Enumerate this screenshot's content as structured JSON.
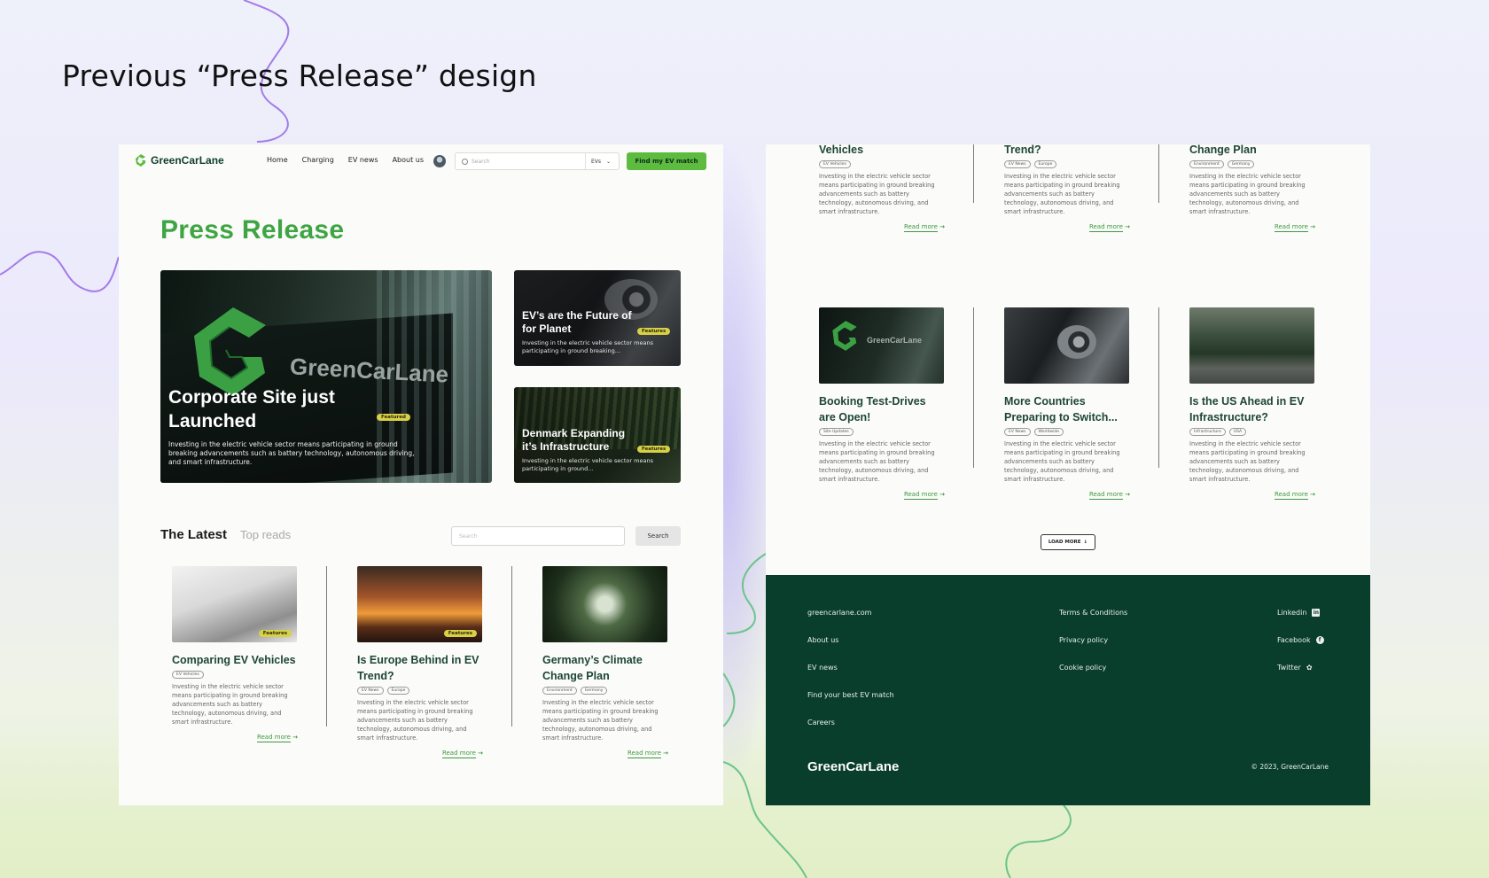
{
  "slide_title": "Previous “Press Release” design",
  "colors": {
    "brand_green": "#3fa544",
    "cta_green": "#5dbb3f",
    "footer_green": "#093d2c",
    "featured_badge": "#d8d046",
    "card_title": "#1d4636"
  },
  "nav": {
    "logo": "GreenCarLane",
    "links": [
      "Home",
      "Charging",
      "EV news",
      "About us"
    ],
    "search_placeholder": "Search",
    "filter_value": "EVs",
    "cta": "Find my EV match"
  },
  "page_title": "Press Release",
  "hero": {
    "brand_sign": "GreenCarLane",
    "title": "Corporate Site just Launched",
    "badge": "Featured",
    "desc": "Investing in the electric vehicle sector means participating in ground breaking advancements such as battery technology, autonomous driving, and smart infrastructure."
  },
  "side_cards": [
    {
      "title": "EV’s are the Future of for Planet",
      "badge": "Features",
      "desc": "Investing in the electric vehicle sector means participating in ground breaking..."
    },
    {
      "title": "Denmark Expanding it’s Infrastructure",
      "badge": "Features",
      "desc": "Investing in the electric vehicle sector means participating in ground..."
    }
  ],
  "latest": {
    "tab_active": "The Latest",
    "tab_inactive": "Top reads",
    "search_placeholder": "Search",
    "search_button": "Search"
  },
  "article_desc": "Investing in the electric vehicle sector means participating in ground breaking advancements such as battery technology, autonomous driving, and smart infrastructure.",
  "read_more": "Read more",
  "articles_left": [
    {
      "title": "Comparing EV Vehicles",
      "badge": "Features",
      "tags": [
        "EV Vehicles"
      ]
    },
    {
      "title": "Is Europe Behind in EV Trend?",
      "badge": "Features",
      "tags": [
        "EV News",
        "Europe"
      ]
    },
    {
      "title": "Germany’s Climate Change Plan",
      "badge": "",
      "tags": [
        "Environment",
        "Germany"
      ]
    }
  ],
  "articles_right_top": [
    {
      "title_tail": "Vehicles",
      "tags": [
        "EV Vehicles"
      ]
    },
    {
      "title_tail": "Trend?",
      "tags": [
        "EV News",
        "Europe"
      ]
    },
    {
      "title_tail": "Change Plan",
      "tags": [
        "Environment",
        "Germany"
      ]
    }
  ],
  "articles_right": [
    {
      "title": "Booking Test-Drives are Open!",
      "thumb_brand": "GreenCarLane",
      "tags": [
        "Site Updates"
      ]
    },
    {
      "title": "More Countries Preparing to Switch...",
      "tags": [
        "EV News",
        "Worldwide"
      ]
    },
    {
      "title": "Is the US Ahead in EV Infrastructure?",
      "tags": [
        "Infrastructure",
        "USA"
      ]
    }
  ],
  "load_more": "LOAD MORE",
  "footer": {
    "col1": [
      "greencarlane.com",
      "About us",
      "EV news",
      "Find your best EV match",
      "Careers"
    ],
    "col2": [
      "Terms & Conditions",
      "Privacy policy",
      "Cookie policy"
    ],
    "social": [
      {
        "label": "Linkedin",
        "icon": "linkedin-icon"
      },
      {
        "label": "Facebook",
        "icon": "facebook-icon"
      },
      {
        "label": "Twitter",
        "icon": "twitter-icon"
      }
    ],
    "logo": "GreenCarLane",
    "copyright": "© 2023, GreenCarLane"
  }
}
